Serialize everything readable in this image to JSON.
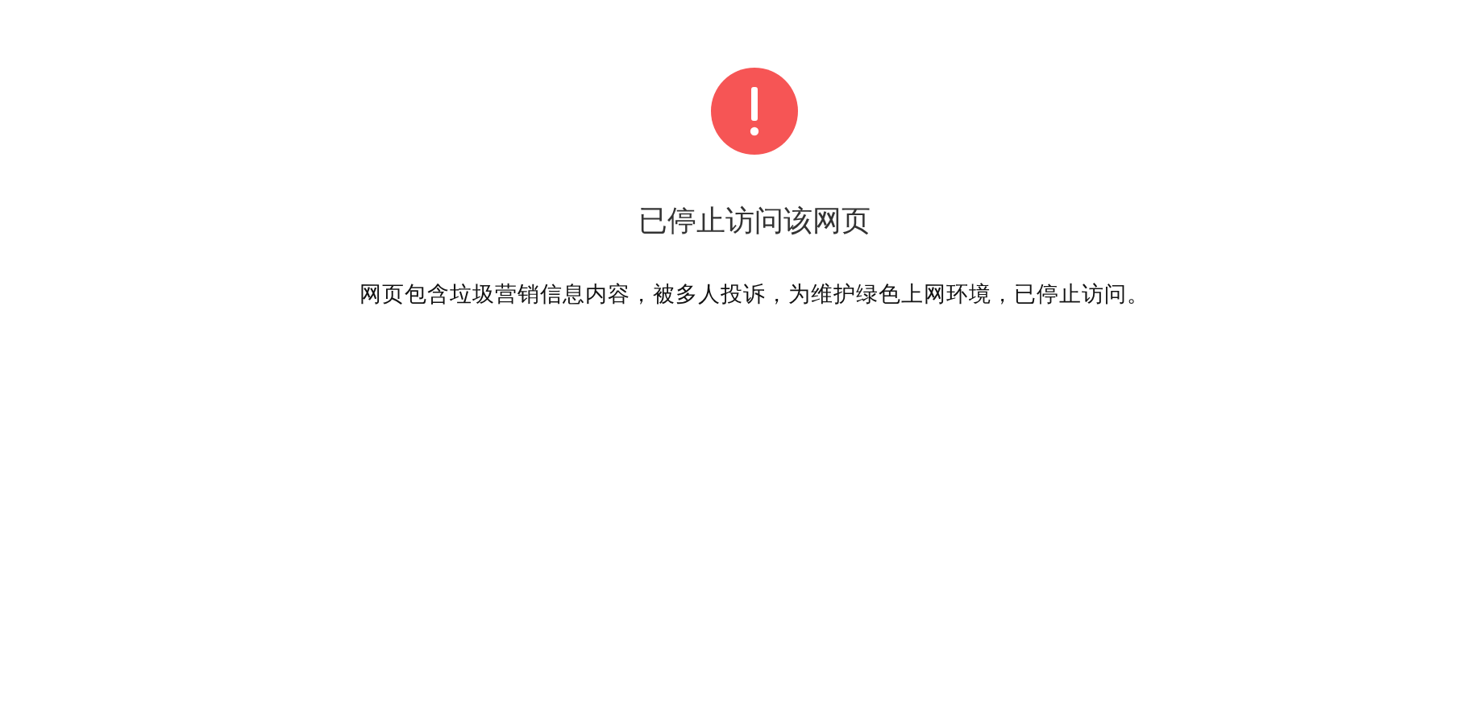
{
  "notice": {
    "title": "已停止访问该网页",
    "message": "网页包含垃圾营销信息内容，被多人投诉，为维护绿色上网环境，已停止访问。"
  }
}
